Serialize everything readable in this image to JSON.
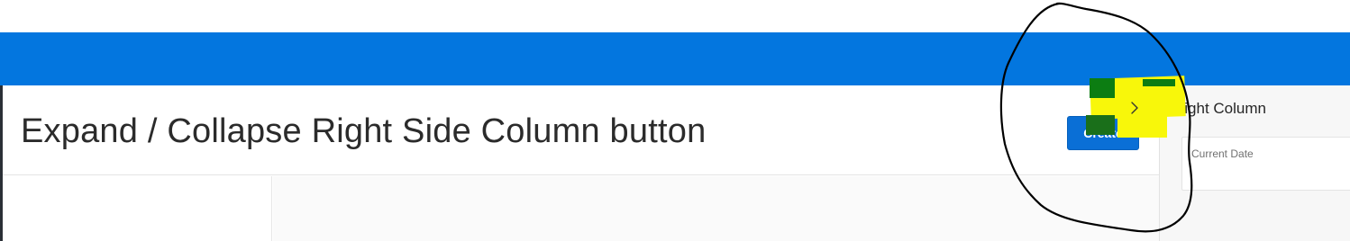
{
  "page": {
    "title": "Expand / Collapse Right Side Column button"
  },
  "hero": {
    "create_label": "Create"
  },
  "right_column": {
    "toggle_icon": "chevron-right-icon",
    "title": "Right Column",
    "current_date_label": "Current Date"
  },
  "colors": {
    "header": "#0376df",
    "button": "#0a6fd6",
    "highlight_yellow": "#f8f70a",
    "highlight_green": "#0c7d12",
    "annotation_ink": "#000000"
  }
}
